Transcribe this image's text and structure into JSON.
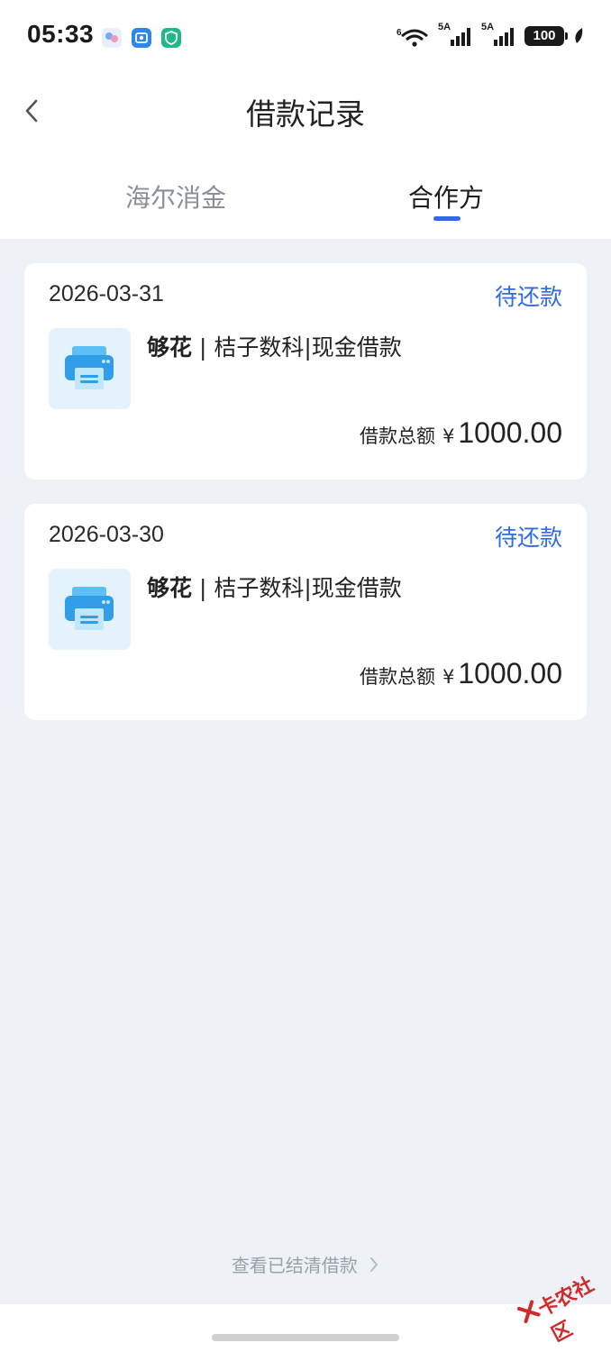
{
  "status_bar": {
    "time": "05:33",
    "network_1": "5A",
    "network_2": "5A",
    "battery": "100",
    "notification_icons": [
      "gallery-icon",
      "photo-icon",
      "shield-icon"
    ]
  },
  "header": {
    "title": "借款记录",
    "back_icon": "chevron-left-icon"
  },
  "tabs": [
    {
      "label": "海尔消金",
      "active": false
    },
    {
      "label": "合作方",
      "active": true
    }
  ],
  "loans": [
    {
      "date": "2026-03-31",
      "status": "待还款",
      "brand": "够花",
      "separator": " | ",
      "product": "桔子数科|现金借款",
      "amount_label": "借款总额",
      "currency": "¥",
      "amount": "1000.00"
    },
    {
      "date": "2026-03-30",
      "status": "待还款",
      "brand": "够花",
      "separator": " | ",
      "product": "桔子数科|现金借款",
      "amount_label": "借款总额",
      "currency": "¥",
      "amount": "1000.00"
    }
  ],
  "footer": {
    "cleared_link": "查看已结清借款"
  },
  "watermark": {
    "text": "卡农社区"
  },
  "colors": {
    "accent": "#2f6be6",
    "background": "#eef2f6",
    "card": "#ffffff",
    "icon_bg": "#e4f2fc"
  }
}
